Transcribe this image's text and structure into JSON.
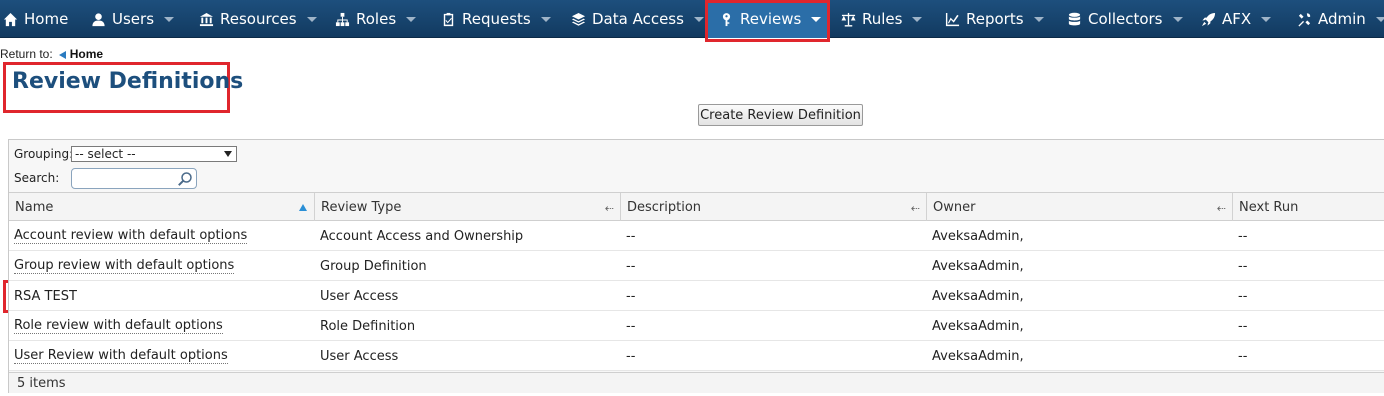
{
  "nav": {
    "items": [
      {
        "label": "Home",
        "icon": "home-icon",
        "caret": false
      },
      {
        "label": "Users",
        "icon": "user-icon",
        "caret": true
      },
      {
        "label": "Resources",
        "icon": "bank-icon",
        "caret": true
      },
      {
        "label": "Roles",
        "icon": "sitemap-icon",
        "caret": true
      },
      {
        "label": "Requests",
        "icon": "checklist-icon",
        "caret": true
      },
      {
        "label": "Data Access",
        "icon": "layers-icon",
        "caret": true
      },
      {
        "label": "Reviews",
        "icon": "key-icon",
        "caret": true,
        "active": true
      },
      {
        "label": "Rules",
        "icon": "scale-icon",
        "caret": true
      },
      {
        "label": "Reports",
        "icon": "chart-icon",
        "caret": true
      },
      {
        "label": "Collectors",
        "icon": "database-icon",
        "caret": true
      },
      {
        "label": "AFX",
        "icon": "rocket-icon",
        "caret": true
      },
      {
        "label": "Admin",
        "icon": "tools-icon",
        "caret": true
      }
    ]
  },
  "breadcrumb": {
    "prefix": "Return to:",
    "link": "Home"
  },
  "page": {
    "title": "Review Definitions",
    "create_button": "Create Review Definition"
  },
  "filters": {
    "grouping_label": "Grouping:",
    "grouping_value": "-- select --",
    "search_label": "Search:",
    "search_value": ""
  },
  "table": {
    "columns": [
      "Name",
      "Review Type",
      "Description",
      "Owner",
      "Next Run"
    ],
    "rows": [
      {
        "name": "Account review with default options",
        "type": "Account Access and Ownership",
        "description": "--",
        "owner": "AveksaAdmin,",
        "next_run": "--"
      },
      {
        "name": "Group review with default options",
        "type": "Group Definition",
        "description": "--",
        "owner": "AveksaAdmin,",
        "next_run": "--"
      },
      {
        "name": "RSA TEST",
        "type": "User Access",
        "description": "--",
        "owner": "AveksaAdmin,",
        "next_run": "--"
      },
      {
        "name": "Role review with default options",
        "type": "Role Definition",
        "description": "--",
        "owner": "AveksaAdmin,",
        "next_run": "--"
      },
      {
        "name": "User Review with default options",
        "type": "User Access",
        "description": "--",
        "owner": "AveksaAdmin,",
        "next_run": "--"
      }
    ],
    "footer": "5 items"
  },
  "colors": {
    "nav_bg": "#1d4f7d",
    "active_tab": "#2b6ea8",
    "highlight": "#e0262d",
    "title": "#1d4f7d"
  }
}
